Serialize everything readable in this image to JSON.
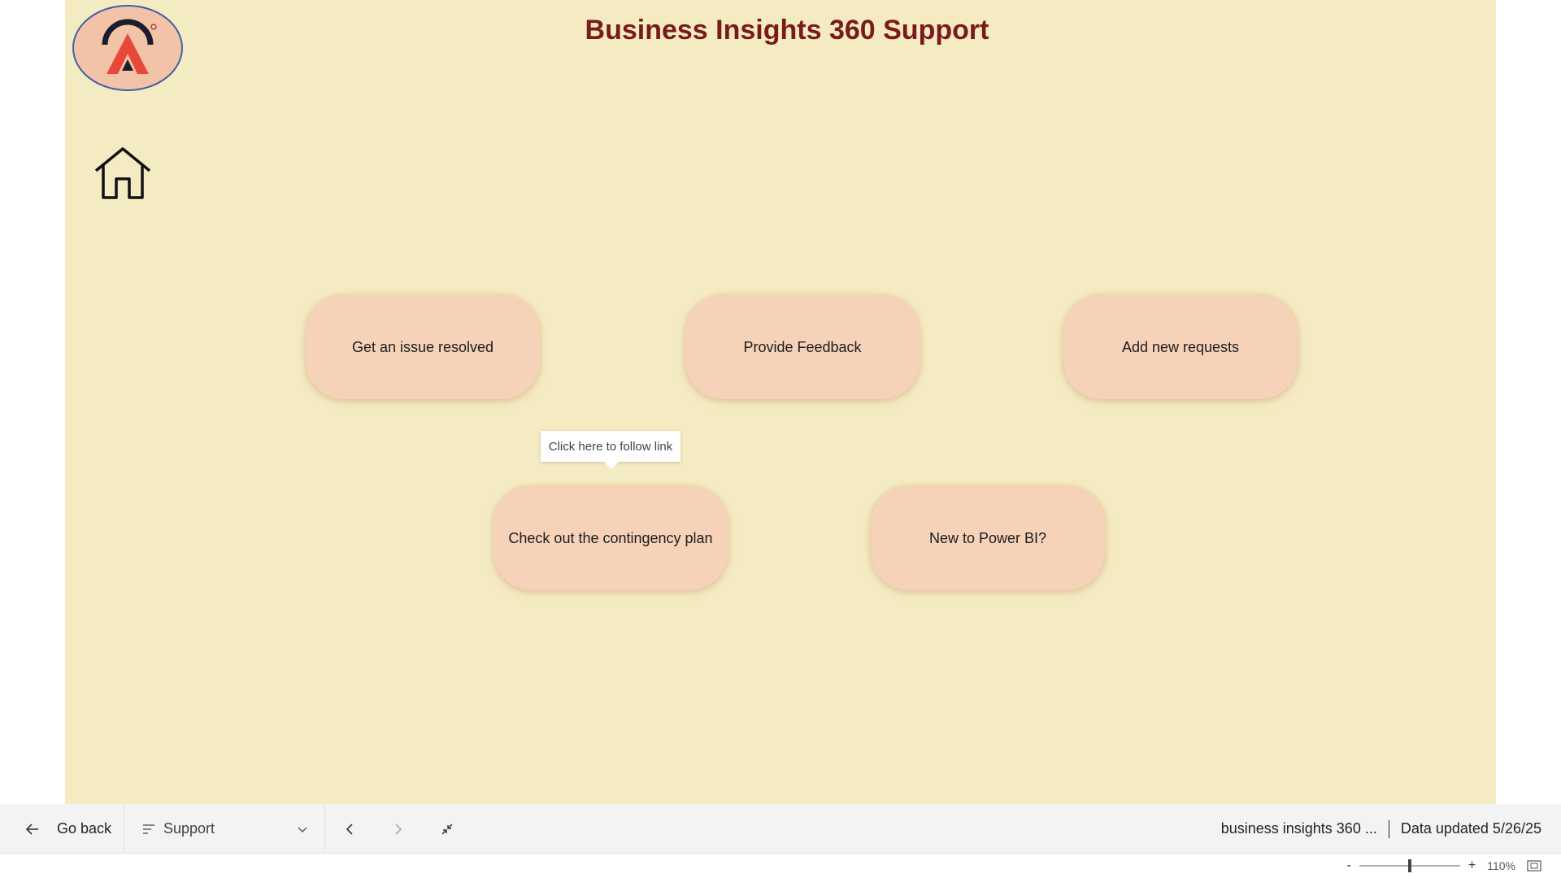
{
  "report": {
    "title": "Business Insights 360 Support",
    "background": "#f5ebc2",
    "title_color": "#7a1a1a"
  },
  "logo": {
    "icon": "atliq-logo-icon",
    "colors": [
      "#f3c3a8",
      "#e8483a",
      "#1c1c2e"
    ]
  },
  "home": {
    "icon": "home-icon"
  },
  "buttons": {
    "issue": "Get an issue resolved",
    "feedback": "Provide Feedback",
    "requests": "Add new requests",
    "contingency": "Check out the contingency plan",
    "new_to_powerbi": "New to Power BI?",
    "fill_color": "#f5d2b8"
  },
  "tooltip": {
    "text": "Click here to follow link"
  },
  "bottombar": {
    "go_back_label": "Go back",
    "page_selected": "Support",
    "report_name": "business insights 360 ...",
    "data_updated": "Data updated 5/26/25",
    "icons": [
      "arrow-left-icon",
      "list-icon",
      "chevron-down-icon",
      "chevron-left-icon",
      "chevron-right-icon",
      "exit-fullscreen-icon"
    ]
  },
  "statusbar": {
    "zoom_minus": "-",
    "zoom_plus": "+",
    "zoom_level": "110%",
    "zoom_fraction": 0.5
  }
}
